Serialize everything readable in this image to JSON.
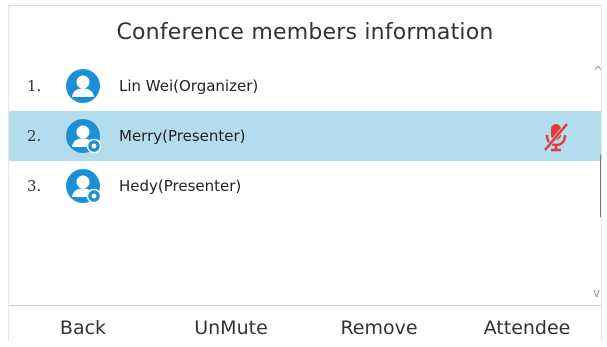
{
  "header": {
    "title": "Conference members information"
  },
  "members": [
    {
      "index": "1.",
      "name": "Lin Wei(Organizer)",
      "avatar": "person-icon",
      "selected": false,
      "muted": false
    },
    {
      "index": "2.",
      "name": "Merry(Presenter)",
      "avatar": "person-presenter-icon",
      "selected": true,
      "muted": true
    },
    {
      "index": "3.",
      "name": "Hedy(Presenter)",
      "avatar": "person-presenter-icon",
      "selected": false,
      "muted": false
    }
  ],
  "icons": {
    "avatar_color": "#1d8fd6",
    "mute_color": "#e23a3a",
    "scroll_up": "^",
    "scroll_down": "v"
  },
  "colors": {
    "selected_row": "#b3dcec"
  },
  "softkeys": [
    "Back",
    "UnMute",
    "Remove",
    "Attendee"
  ]
}
